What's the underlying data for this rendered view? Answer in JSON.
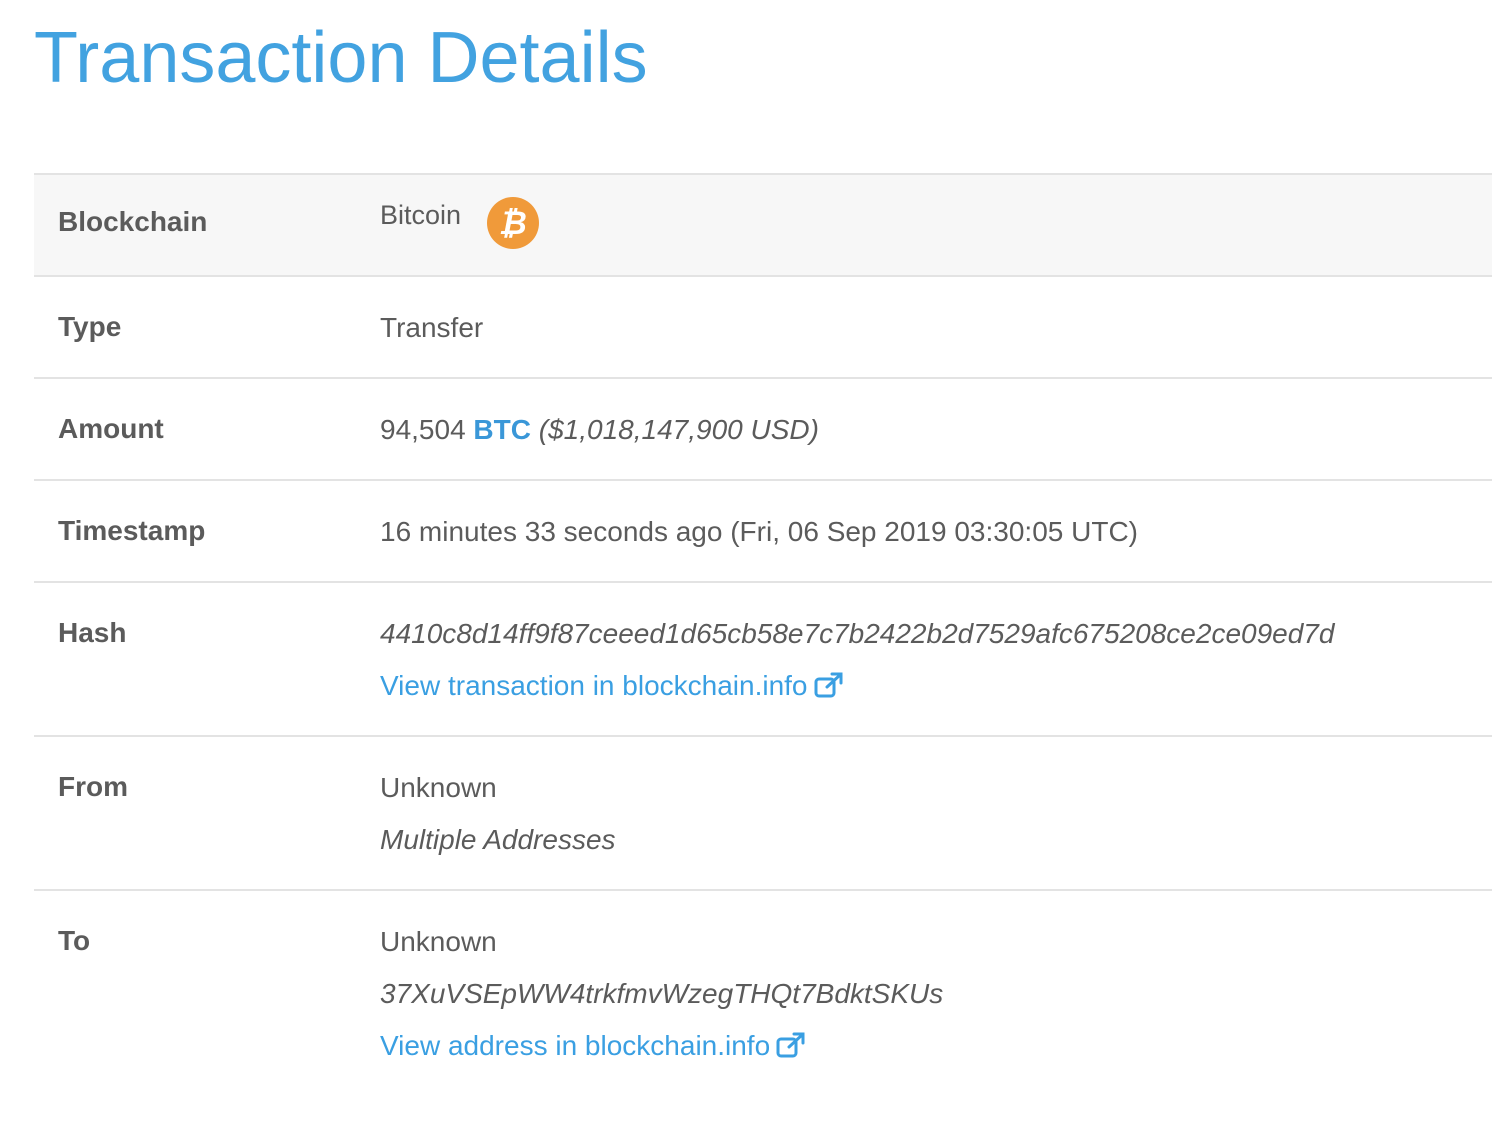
{
  "page": {
    "title": "Transaction Details"
  },
  "details": {
    "blockchain": {
      "label": "Blockchain",
      "value": "Bitcoin",
      "icon": "bitcoin-icon",
      "icon_glyph": "₿",
      "icon_color": "#f09a3a"
    },
    "type": {
      "label": "Type",
      "value": "Transfer"
    },
    "amount": {
      "label": "Amount",
      "quantity": "94,504",
      "symbol": "BTC",
      "usd": "($1,018,147,900 USD)"
    },
    "timestamp": {
      "label": "Timestamp",
      "value": "16 minutes 33 seconds ago (Fri, 06 Sep 2019 03:30:05 UTC)"
    },
    "hash": {
      "label": "Hash",
      "value": "4410c8d14ff9f87ceeed1d65cb58e7c7b2422b2d7529afc675208ce2ce09ed7d",
      "link": "View transaction in blockchain.info",
      "link_icon": "external-link-icon"
    },
    "from": {
      "label": "From",
      "owner": "Unknown",
      "address": "Multiple Addresses"
    },
    "to": {
      "label": "To",
      "owner": "Unknown",
      "address": "37XuVSEpWW4trkfmvWzegTHQt7BdktSKUs",
      "link": "View address in blockchain.info",
      "link_icon": "external-link-icon"
    }
  },
  "colors": {
    "title": "#42a2e0",
    "link": "#3a9fe2",
    "border": "#e3e3e3",
    "shaded_row": "#f7f7f7"
  }
}
